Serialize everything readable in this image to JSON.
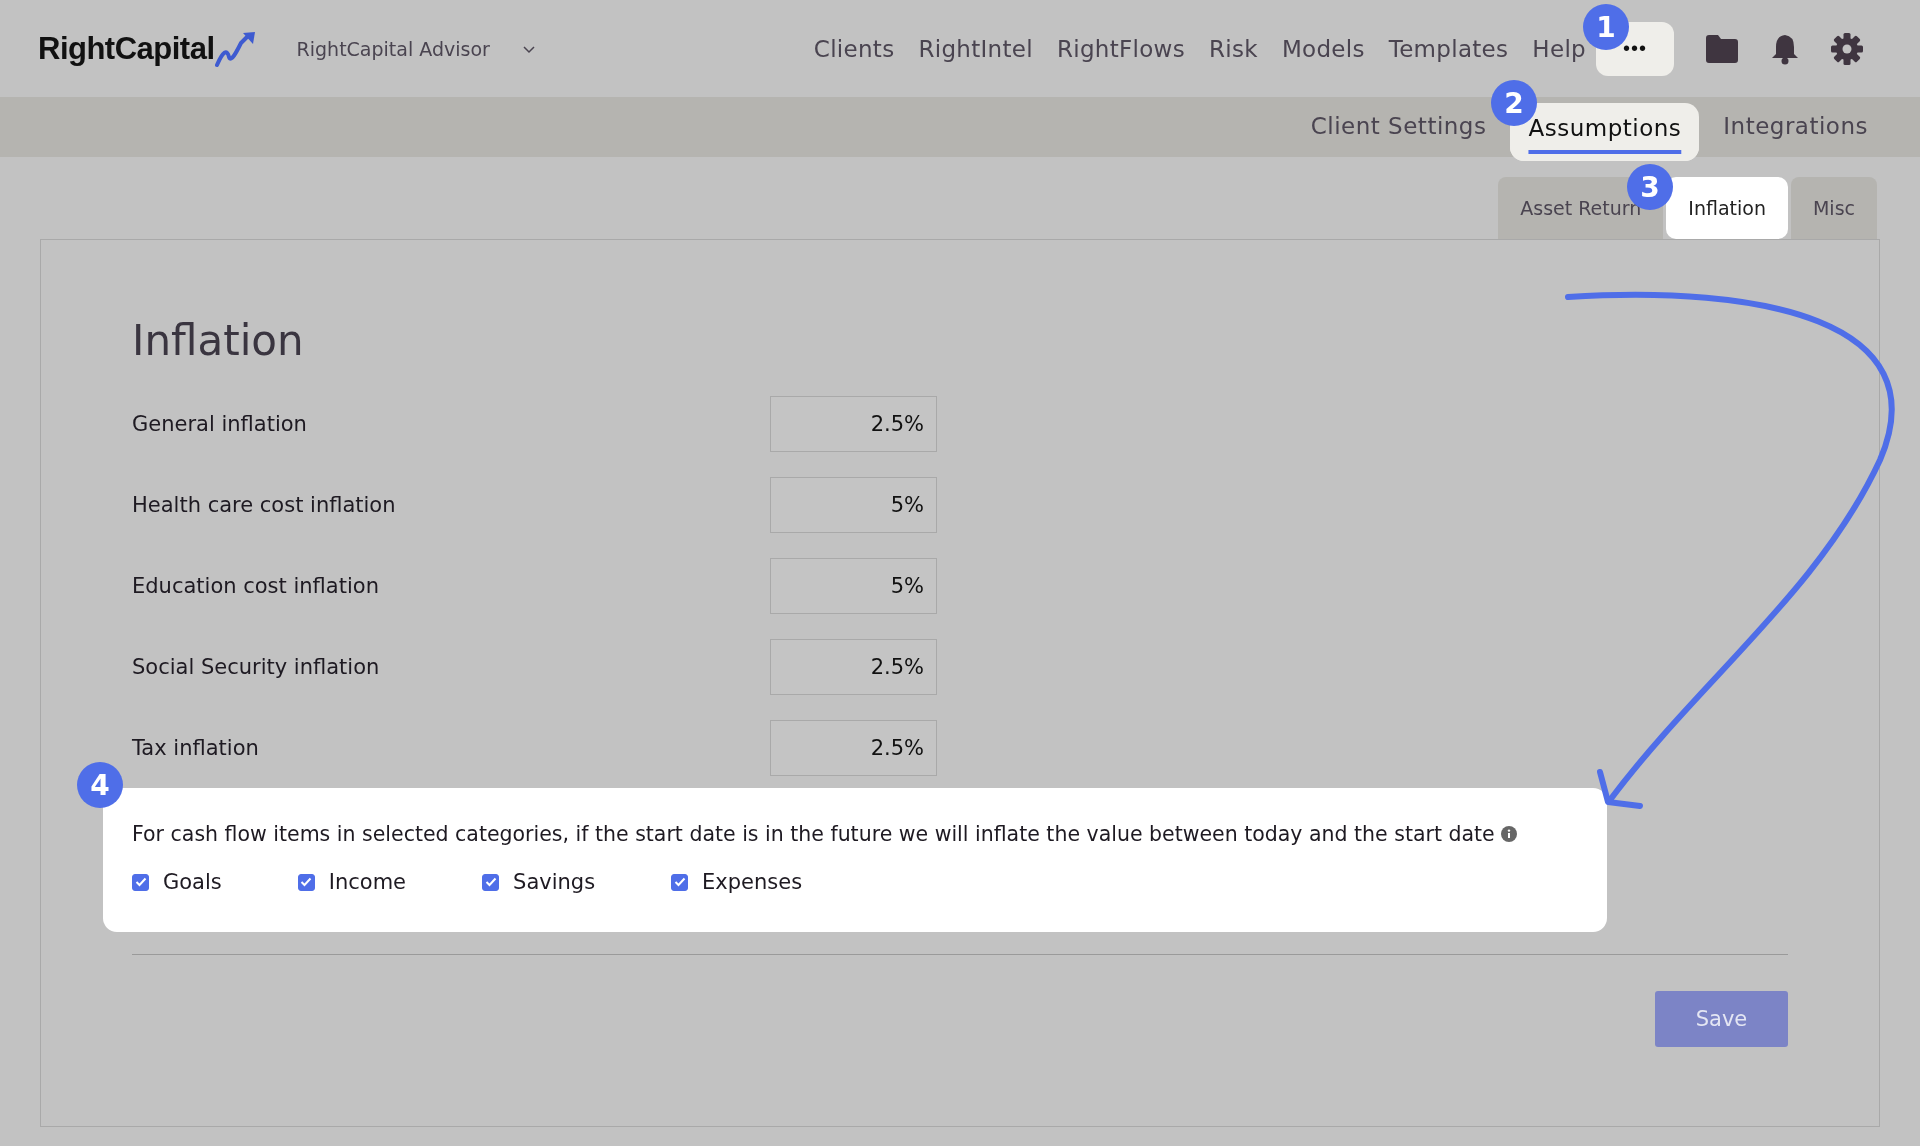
{
  "header": {
    "logo": "RightCapital",
    "advisor": "RightCapital Advisor",
    "nav": [
      {
        "label": "Clients"
      },
      {
        "label": "RightIntel"
      },
      {
        "label": "RightFlows"
      },
      {
        "label": "Risk"
      },
      {
        "label": "Models"
      },
      {
        "label": "Templates"
      },
      {
        "label": "Help"
      }
    ],
    "more_button": "•••"
  },
  "subnav": [
    {
      "label": "Client Settings",
      "selected": false
    },
    {
      "label": "Assumptions",
      "selected": true
    },
    {
      "label": "Integrations",
      "selected": false
    }
  ],
  "tabs": [
    {
      "label": "Asset Return",
      "selected": false
    },
    {
      "label": "Inflation",
      "selected": true
    },
    {
      "label": "Misc",
      "selected": false
    }
  ],
  "title": "Inflation",
  "fields": [
    {
      "label": "General inflation",
      "value": "2.5%"
    },
    {
      "label": "Health care cost inflation",
      "value": "5%"
    },
    {
      "label": "Education cost inflation",
      "value": "5%"
    },
    {
      "label": "Social Security inflation",
      "value": "2.5%"
    },
    {
      "label": "Tax inflation",
      "value": "2.5%"
    }
  ],
  "note": "For cash flow items in selected categories, if the start date is in the future we will inflate the value between today and the start date",
  "categories": [
    {
      "label": "Goals",
      "checked": true
    },
    {
      "label": "Income",
      "checked": true
    },
    {
      "label": "Savings",
      "checked": true
    },
    {
      "label": "Expenses",
      "checked": true
    }
  ],
  "save_button": "Save",
  "callouts": [
    "1",
    "2",
    "3",
    "4"
  ]
}
